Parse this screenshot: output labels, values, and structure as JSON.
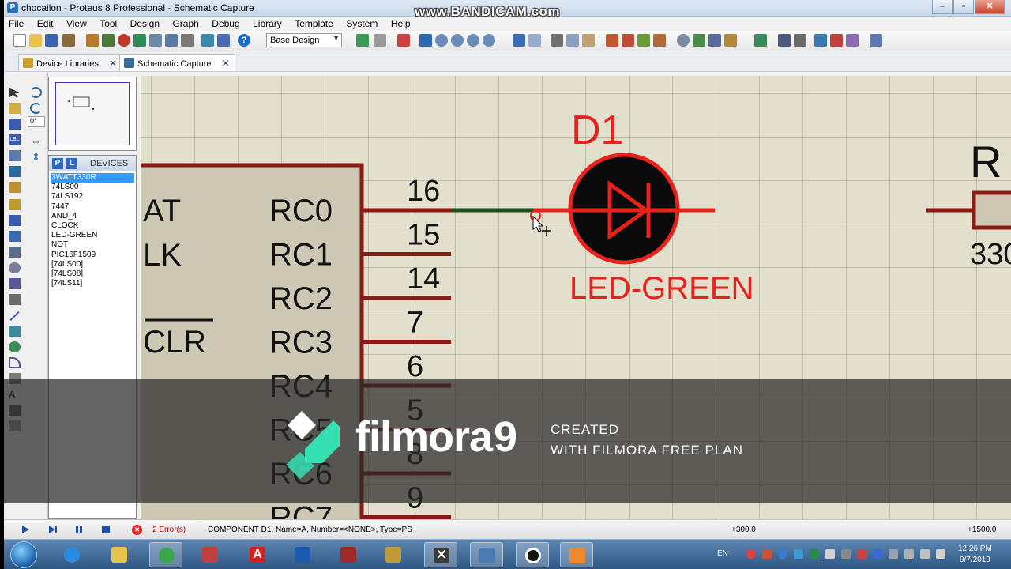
{
  "window": {
    "title": "chocailon - Proteus 8 Professional - Schematic Capture",
    "recording_watermark": "www.BANDICAM.com"
  },
  "menu": [
    "File",
    "Edit",
    "View",
    "Tool",
    "Design",
    "Graph",
    "Debug",
    "Library",
    "Template",
    "System",
    "Help"
  ],
  "toolbar": {
    "design_select": "Base Design"
  },
  "tabs": [
    {
      "label": "Device Libraries",
      "active": false
    },
    {
      "label": "Schematic Capture",
      "active": true
    }
  ],
  "left_panel": {
    "rotation_value": "0°",
    "devices_header": "DEVICES",
    "pick_button": "P",
    "library_button": "L",
    "devices": [
      "3WATT330R",
      "74LS00",
      "74LS192",
      "7447",
      "AND_4",
      "CLOCK",
      "LED-GREEN",
      "NOT",
      "PIC16F1509",
      "[74LS00]",
      "[74LS08]",
      "[74LS11]"
    ],
    "selected_device": "3WATT330R"
  },
  "schematic": {
    "chip_left_pins": [
      "AT",
      "LK",
      "CLR"
    ],
    "chip_right_pins": [
      {
        "name": "RC0",
        "number": "16"
      },
      {
        "name": "RC1",
        "number": "15"
      },
      {
        "name": "RC2",
        "number": "14"
      },
      {
        "name": "RC3",
        "number": "7"
      },
      {
        "name": "RC4",
        "number": "6"
      },
      {
        "name": "RC5",
        "number": "5"
      },
      {
        "name": "RC6",
        "number": "8"
      },
      {
        "name": "RC7",
        "number": "9"
      }
    ],
    "diode_ref": "D1",
    "diode_value": "LED-GREEN",
    "resistor_ref": "R",
    "resistor_value": "330",
    "colors": {
      "component": "#e8211c",
      "pin": "#8b1a14",
      "wire": "#1f4e1f",
      "body": "#cdc8b4"
    }
  },
  "overlay": {
    "brand": "filmora",
    "version": "9",
    "line1": "CREATED",
    "line2": "WITH FILMORA FREE PLAN"
  },
  "status": {
    "errors": "2 Error(s)",
    "message": "COMPONENT D1, Name=A, Number=<NONE>, Type=PS",
    "coord_x": "+300.0",
    "coord_y": "+1500.0"
  },
  "taskbar": {
    "language": "EN",
    "time": "12:26 PM",
    "date": "9/7/2019"
  }
}
